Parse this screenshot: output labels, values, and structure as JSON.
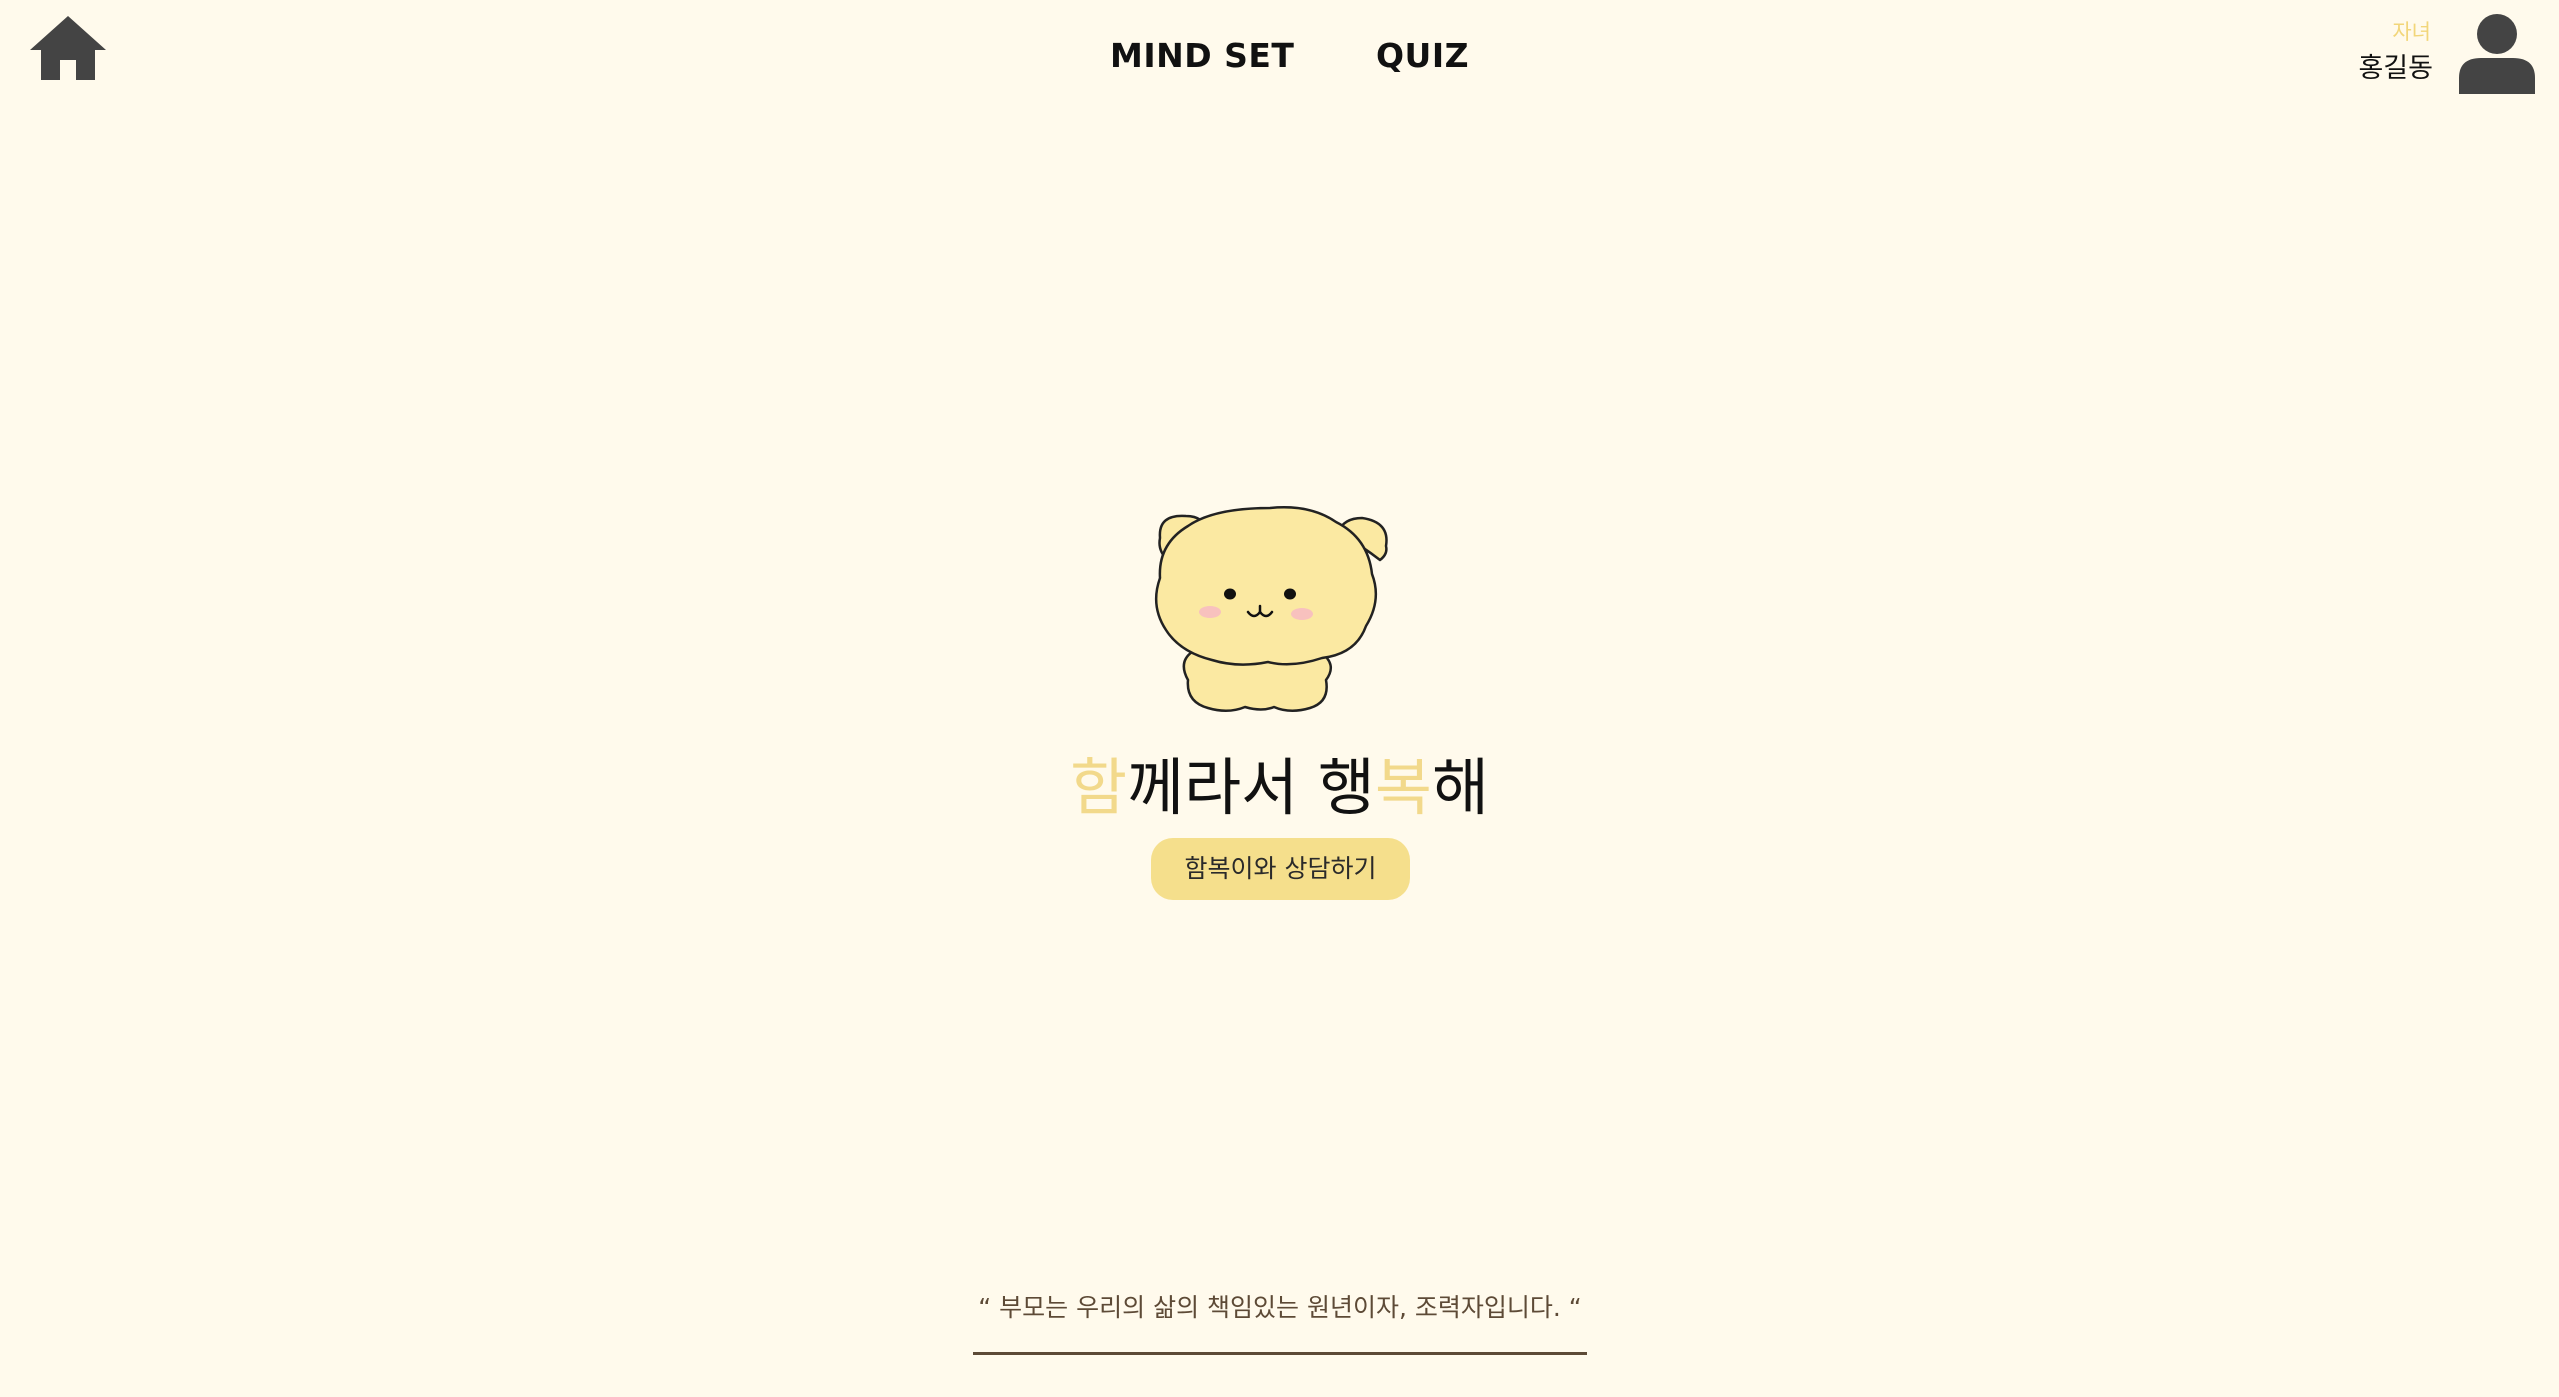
{
  "nav": {
    "home_icon": "home-icon",
    "mindset_label": "MIND SET",
    "quiz_label": "QUIZ"
  },
  "user": {
    "role": "자녀",
    "name": "홍길동",
    "avatar_icon": "user-avatar-icon"
  },
  "hero": {
    "mascot": "mascot-bear",
    "slogan": {
      "char1": "함",
      "part1": "께라서 행",
      "char2": "복",
      "part2": "해"
    },
    "consult_button": "함복이와 상담하기"
  },
  "footer": {
    "quote": "“ 부모는 우리의 삶의 책임있는 원년이자, 조력자입니다. “"
  },
  "colors": {
    "background": "#fffaec",
    "accent": "#f5df8c",
    "accent_text": "#f2d98b",
    "icon_gray": "#444444",
    "quote_brown": "#5d4a36"
  }
}
